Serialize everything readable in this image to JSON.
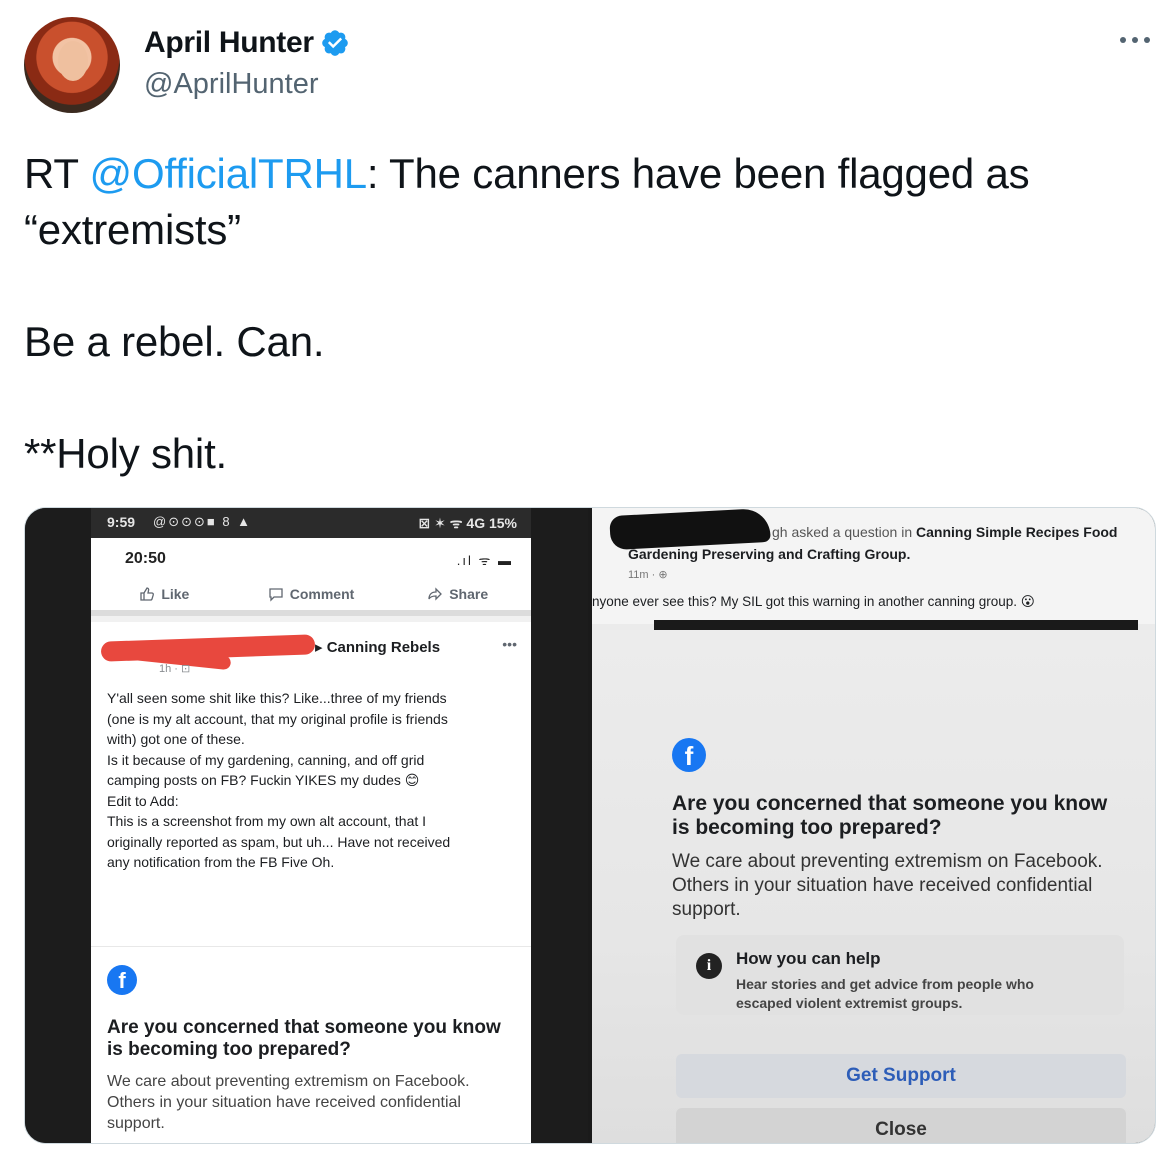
{
  "author": {
    "display_name": "April Hunter",
    "handle": "@AprilHunter",
    "verified": true
  },
  "more_icon": "more-dots-icon",
  "tweet": {
    "prefix": "RT ",
    "mention": "@OfficialTRHL",
    "line1_rest": ": The canners have been flagged as",
    "line2": "“extremists”",
    "line3": "Be a rebel. Can.",
    "line4": "**Holy shit."
  },
  "media": {
    "left": {
      "status_time": "9:59",
      "status_icons": "@⊙⊙⊙■ 8 ▲",
      "status_right": "⊠ ✶ ᯤ 4G 15%",
      "inner_time": "20:50",
      "inner_signal": ".ıl ᯤ ▬",
      "actions": [
        "Like",
        "Comment",
        "Share"
      ],
      "group_name": "▸ Canning Rebels",
      "post_more": "•••",
      "post_meta": "1h · ⊡",
      "post_body": [
        "Y'all seen some shit like this? Like...three of my friends",
        "(one is my alt account, that my original profile is friends",
        "with) got one of these.",
        "Is it because of my gardening, canning, and off grid",
        "camping posts on FB? Fuckin YIKES my dudes 😊",
        "Edit to Add:",
        "This is a screenshot from my own alt account, that I",
        "originally reported as spam, but uh... Have not received",
        "any notification from the FB Five Oh."
      ],
      "fb_logo": "f",
      "fb_title": "Are you concerned that someone you know is becoming too prepared?",
      "fb_desc": "We care about preventing extremism on Facebook. Others in your situation have received confidential support."
    },
    "right": {
      "asked": "gh asked a question",
      "in_word": " in ",
      "group_part1": "Canning Simple Recipes Food",
      "group_part2": "Gardening Preserving and Crafting Group.",
      "meta": "11m · ⊕",
      "question": "nyone ever see this? My SIL got this warning in another canning group. 😮",
      "fb_logo": "f",
      "fb_title": "Are you concerned that someone you know is becoming too prepared?",
      "fb_desc": "We care about preventing extremism on Facebook. Others in your situation have received confidential support.",
      "help_title": "How you can help",
      "help_desc": "Hear stories and get advice from people who escaped violent extremist groups.",
      "support_label": "Get Support",
      "close_label": "Close"
    }
  }
}
